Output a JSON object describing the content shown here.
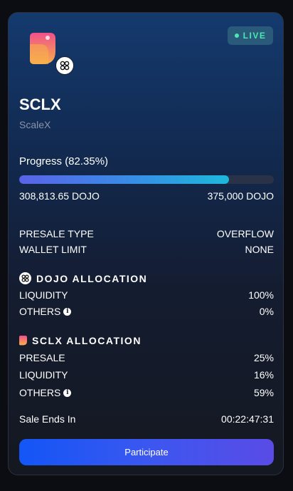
{
  "token": {
    "symbol": "SCLX",
    "name": "ScaleX",
    "status": "LIVE",
    "logo_icon": "sclx-logo-icon",
    "chain_icon": "dojo-icon"
  },
  "progress": {
    "label": "Progress (82.35%)",
    "percent": 82.35,
    "raised": "308,813.65 DOJO",
    "goal": "375,000 DOJO"
  },
  "presale": {
    "type_label": "PRESALE TYPE",
    "type_value": "OVERFLOW",
    "limit_label": "WALLET LIMIT",
    "limit_value": "NONE"
  },
  "dojo_allocation": {
    "title": "DOJO ALLOCATION",
    "rows": [
      {
        "label": "LIQUIDITY",
        "value": "100%"
      },
      {
        "label": "OTHERS",
        "value": "0%"
      }
    ]
  },
  "sclx_allocation": {
    "title": "SCLX ALLOCATION",
    "rows": [
      {
        "label": "PRESALE",
        "value": "25%"
      },
      {
        "label": "LIQUIDITY",
        "value": "16%"
      },
      {
        "label": "OTHERS",
        "value": "59%"
      }
    ]
  },
  "sale": {
    "label": "Sale Ends In",
    "countdown": "00:22:47:31"
  },
  "actions": {
    "participate_label": "Participate"
  },
  "colors": {
    "live": "#4be7b0",
    "button_start": "#1356f6",
    "button_end": "#5a4be6"
  }
}
